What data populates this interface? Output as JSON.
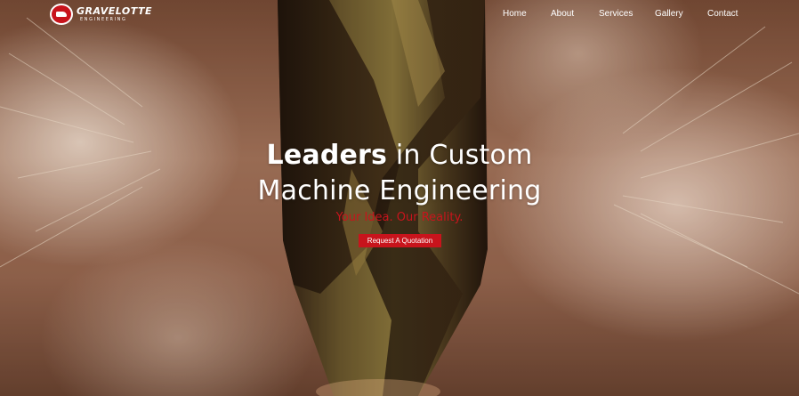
{
  "brand": {
    "name": "GRAVELOTTE",
    "subtitle": "ENGINEERING",
    "logo_icon": "anvil-badge-icon",
    "accent_color": "#c8141c"
  },
  "nav": {
    "items": [
      {
        "label": "Home"
      },
      {
        "label": "About"
      },
      {
        "label": "Services"
      },
      {
        "label": "Gallery"
      },
      {
        "label": "Contact"
      }
    ]
  },
  "hero": {
    "headline_strong": "Leaders",
    "headline_rest_line1": " in Custom",
    "headline_line2": "Machine Engineering",
    "tagline": "Your Idea. Our Reality.",
    "cta_label": "Request A Quotation",
    "background_image": "drill-bit-sparks-photo"
  }
}
